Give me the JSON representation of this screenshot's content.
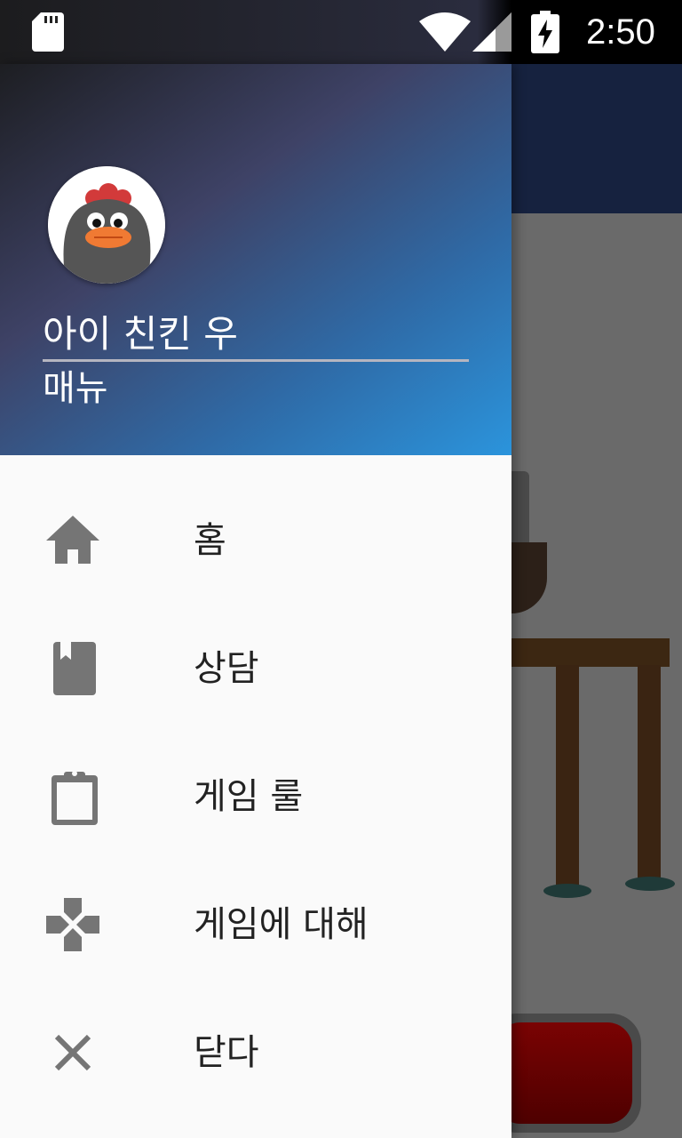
{
  "status_bar": {
    "time": "2:50",
    "icons": [
      "sd-card-icon",
      "wifi-icon",
      "signal-icon",
      "battery-charging-icon"
    ]
  },
  "drawer": {
    "header": {
      "title": "아이 친킨 우",
      "subtitle": "매뉴",
      "avatar": "chicken-avatar"
    },
    "items": [
      {
        "label": "홈",
        "icon": "home-icon"
      },
      {
        "label": "상담",
        "icon": "book-icon"
      },
      {
        "label": "게임 룰",
        "icon": "clipboard-icon"
      },
      {
        "label": "게임에 대해",
        "icon": "gamepad-icon"
      },
      {
        "label": "닫다",
        "icon": "close-icon"
      }
    ]
  },
  "colors": {
    "status_bar": "#1c1c1e",
    "header_gradient_start": "#1d1e22",
    "header_gradient_end": "#2b94dc",
    "drawer_bg": "#fafafa",
    "icon_gray": "#757575",
    "app_toolbar": "#16223f"
  }
}
